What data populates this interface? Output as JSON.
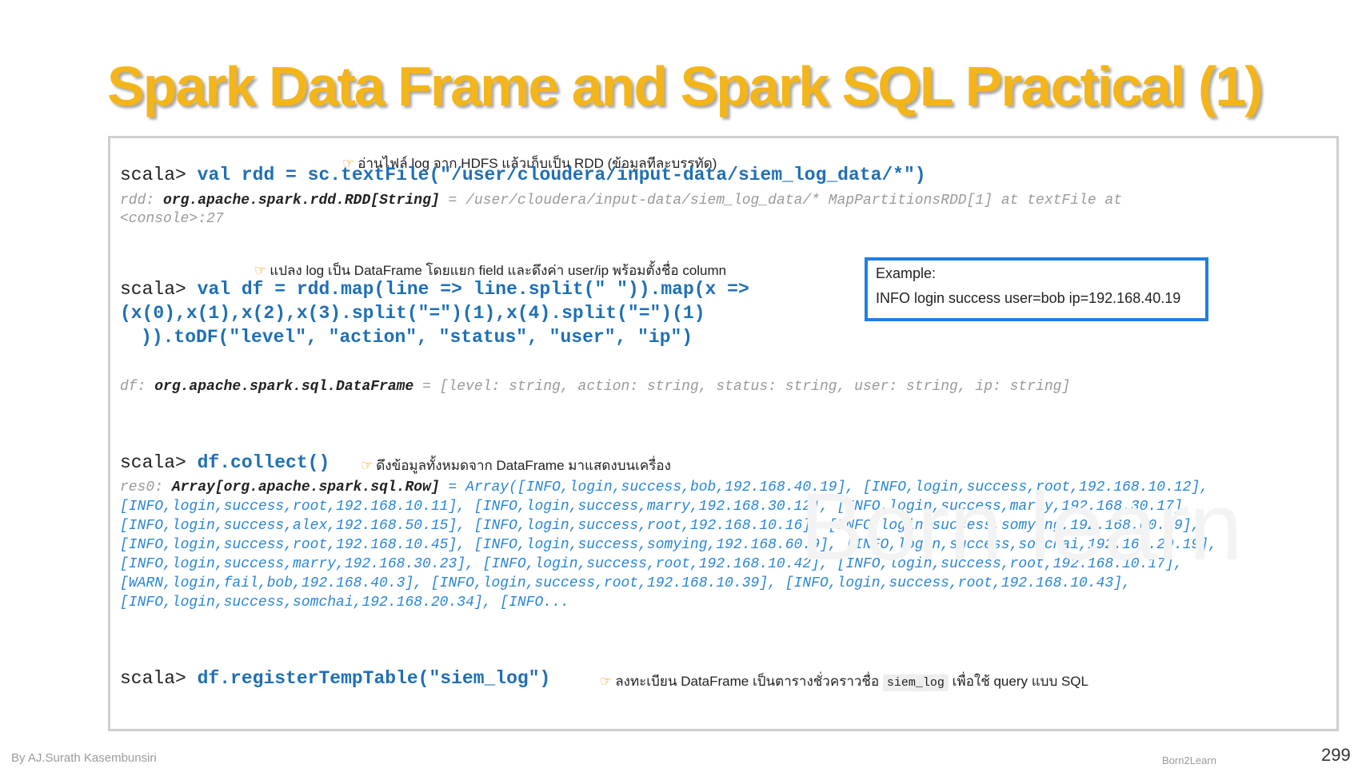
{
  "slide": {
    "title": "Spark Data Frame and Spark SQL Practical (1)",
    "footer_author": "By AJ.Surath Kasembunsiri",
    "footer_brand": "Born2Learn",
    "page_number": "299",
    "watermark": "Born learn"
  },
  "block1": {
    "note": "อ่านไฟล์ log จาก HDFS แล้วเก็บเป็น RDD (ข้อมูลทีละบรรทัด)",
    "prompt": "scala>",
    "code": "val rdd = sc.textFile(\"/user/cloudera/input-data/siem_log_data/*\")",
    "out_name": "rdd:",
    "out_type": "org.apache.spark.rdd.RDD[String]",
    "out_rest": "= /user/cloudera/input-data/siem_log_data/* MapPartitionsRDD[1] at textFile at",
    "out_line2": "<console>:27"
  },
  "block2": {
    "note": "แปลง log เป็น DataFrame โดยแยก field และดึงค่า user/ip พร้อมตั้งชื่อ column",
    "prompt": "scala>",
    "code_line1": "val df = rdd.map(line => line.split(\" \")).map(x =>",
    "code_line2": "(x(0),x(1),x(2),x(3).split(\"=\")(1),x(4).split(\"=\")(1)",
    "code_line3": ")).toDF(\"level\", \"action\", \"status\", \"user\", \"ip\")",
    "out_name": "df:",
    "out_type": "org.apache.spark.sql.DataFrame",
    "out_rest": "= [level: string, action: string, status: string, user: string, ip: string]"
  },
  "example": {
    "label": "Example:",
    "text": "INFO login success user=bob ip=192.168.40.19"
  },
  "block3": {
    "prompt": "scala>",
    "code": "df.collect()",
    "note": "ดึงข้อมูลทั้งหมดจาก DataFrame มาแสดงบนเครื่อง",
    "out_name": "res0:",
    "out_type": "Array[org.apache.spark.sql.Row]",
    "out_first": "= Array([INFO,login,success,bob,192.168.40.19], [INFO,login,success,root,192.168.10.12],",
    "result_lines": [
      "[INFO,login,success,root,192.168.10.11], [INFO,login,success,marry,192.168.30.12], [INFO,login,success,marry,192.168.30.17],",
      "[INFO,login,success,alex,192.168.50.15], [INFO,login,success,root,192.168.10.16], [INFO,login,success,somying,192.168.60.19],",
      "[INFO,login,success,root,192.168.10.45], [INFO,login,success,somying,192.168.60.9], [INFO,login,success,somchai,192.168.20.19],",
      "[INFO,login,success,marry,192.168.30.23], [INFO,login,success,root,192.168.10.42], [INFO,login,success,root,192.168.10.17],",
      "[WARN,login,fail,bob,192.168.40.3], [INFO,login,success,root,192.168.10.39], [INFO,login,success,root,192.168.10.43],",
      "[INFO,login,success,somchai,192.168.20.34], [INFO..."
    ]
  },
  "block4": {
    "prompt": "scala>",
    "code": "df.registerTempTable(\"siem_log\")",
    "note_before": "ลงทะเบียน DataFrame เป็นตารางชั่วคราวชื่อ",
    "note_code": "siem_log",
    "note_after": "เพื่อใช้ query แบบ SQL"
  }
}
